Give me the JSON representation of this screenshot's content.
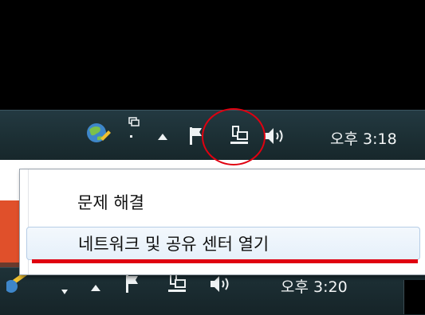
{
  "taskbar_top": {
    "clock": "오후 3:18"
  },
  "context_menu": {
    "items": [
      {
        "label": "문제 해결"
      },
      {
        "label": "네트워크 및 공유 센터 열기"
      }
    ]
  },
  "taskbar_bottom": {
    "clock": "오후 3:20"
  },
  "colors": {
    "highlight_red": "#e00010",
    "taskbar": "#1c2f34"
  }
}
